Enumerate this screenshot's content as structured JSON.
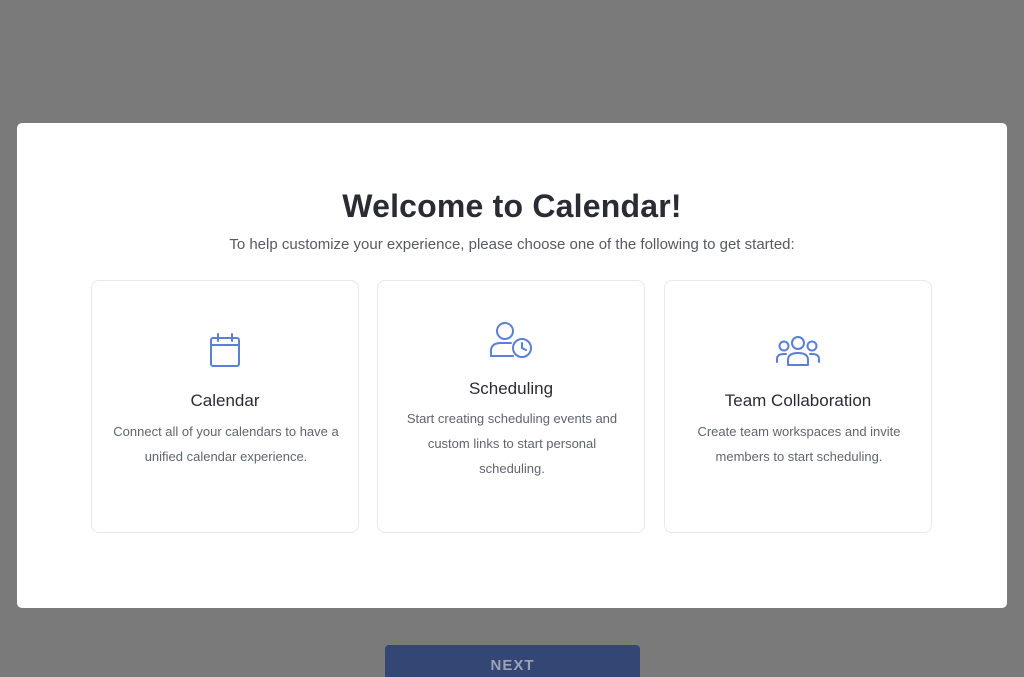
{
  "modal": {
    "title": "Welcome to Calendar!",
    "subtitle": "To help customize your experience, please choose one of the following to get started:"
  },
  "options": [
    {
      "title": "Calendar",
      "description": "Connect all of your calendars to have a unified calendar experience.",
      "icon": "calendar-icon"
    },
    {
      "title": "Scheduling",
      "description": "Start creating scheduling events and custom links to start personal scheduling.",
      "icon": "user-clock-icon"
    },
    {
      "title": "Team Collaboration",
      "description": "Create team workspaces and invite members to start scheduling.",
      "icon": "team-icon"
    }
  ],
  "footer": {
    "next_label": "NEXT"
  },
  "colors": {
    "overlay": "#7a7a7a",
    "icon_accent": "#5b7fd6",
    "button": "#344673"
  }
}
